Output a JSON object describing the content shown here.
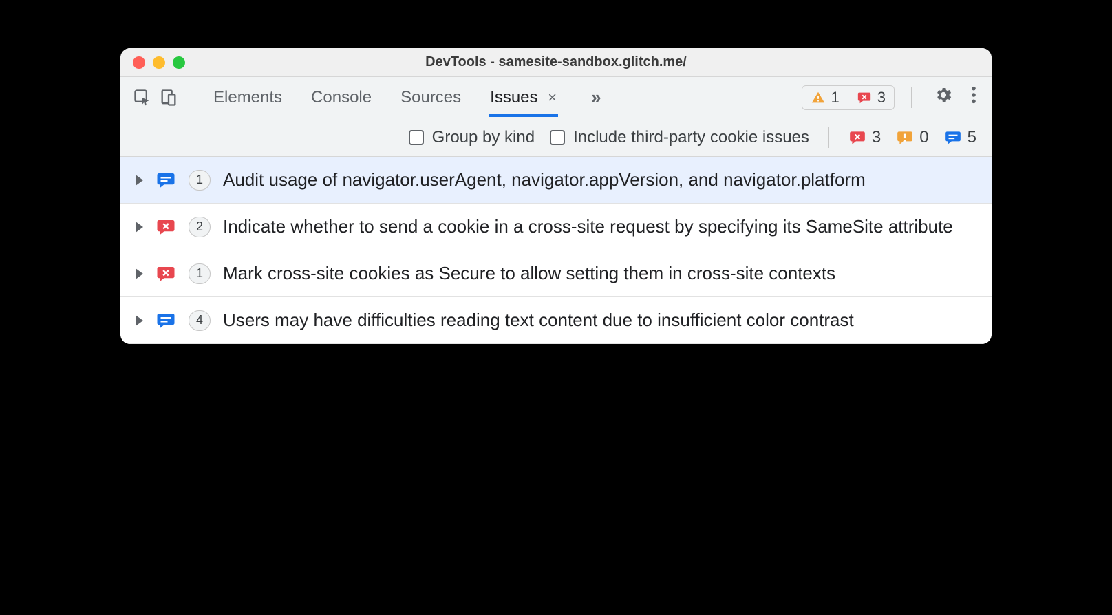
{
  "window": {
    "title": "DevTools - samesite-sandbox.glitch.me/"
  },
  "tabs": {
    "items": [
      "Elements",
      "Console",
      "Sources",
      "Issues"
    ],
    "active": "Issues"
  },
  "toolbar_counters": {
    "warning": "1",
    "error": "3"
  },
  "filter": {
    "group_by_kind_label": "Group by kind",
    "include_third_party_label": "Include third-party cookie issues"
  },
  "stats": {
    "error": "3",
    "warning": "0",
    "info": "5"
  },
  "issues": [
    {
      "type": "info",
      "count": "1",
      "title": "Audit usage of navigator.userAgent, navigator.appVersion, and navigator.platform",
      "selected": true
    },
    {
      "type": "error",
      "count": "2",
      "title": "Indicate whether to send a cookie in a cross-site request by specifying its SameSite attribute",
      "selected": false
    },
    {
      "type": "error",
      "count": "1",
      "title": "Mark cross-site cookies as Secure to allow setting them in cross-site contexts",
      "selected": false
    },
    {
      "type": "info",
      "count": "4",
      "title": "Users may have difficulties reading text content due to insufficient color contrast",
      "selected": false
    }
  ],
  "colors": {
    "error": "#e8474f",
    "warning": "#f1a33a",
    "info": "#1a73e8"
  }
}
